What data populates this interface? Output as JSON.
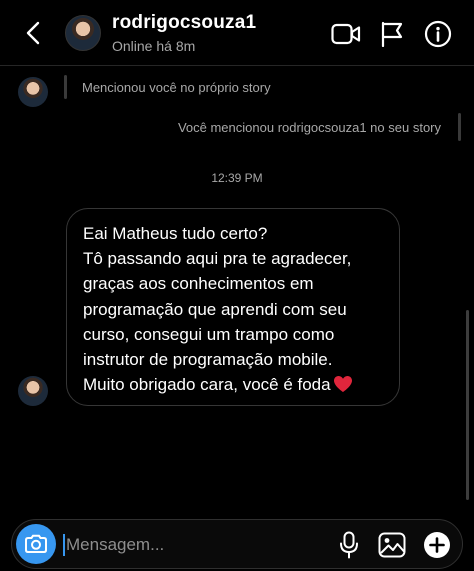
{
  "header": {
    "username": "rodrigocsouza1",
    "status": "Online há 8m",
    "icons": [
      "chevron-left-icon",
      "video-camera-icon",
      "flag-icon",
      "info-icon"
    ]
  },
  "thread": {
    "mention_received": "Mencionou você no próprio story",
    "mention_sent": "Você mencionou rodrigocsouza1 no seu story",
    "timestamp": "12:39 PM",
    "message_lines": [
      "Eai Matheus tudo certo?",
      "Tô passando aqui pra te agradecer,",
      "graças aos conhecimentos em",
      "programação que aprendi com seu",
      "curso, consegui um trampo como",
      "instrutor de programação mobile.",
      "Muito obrigado cara, você é foda"
    ],
    "message_emoji": "heart-icon"
  },
  "composer": {
    "placeholder": "Mensagem...",
    "icons": [
      "camera-icon",
      "microphone-icon",
      "gallery-icon",
      "plus-icon"
    ]
  },
  "colors": {
    "background": "#000000",
    "accent": "#3797f0",
    "heart": "#e0263c",
    "muted_text": "#a8a8a8"
  }
}
